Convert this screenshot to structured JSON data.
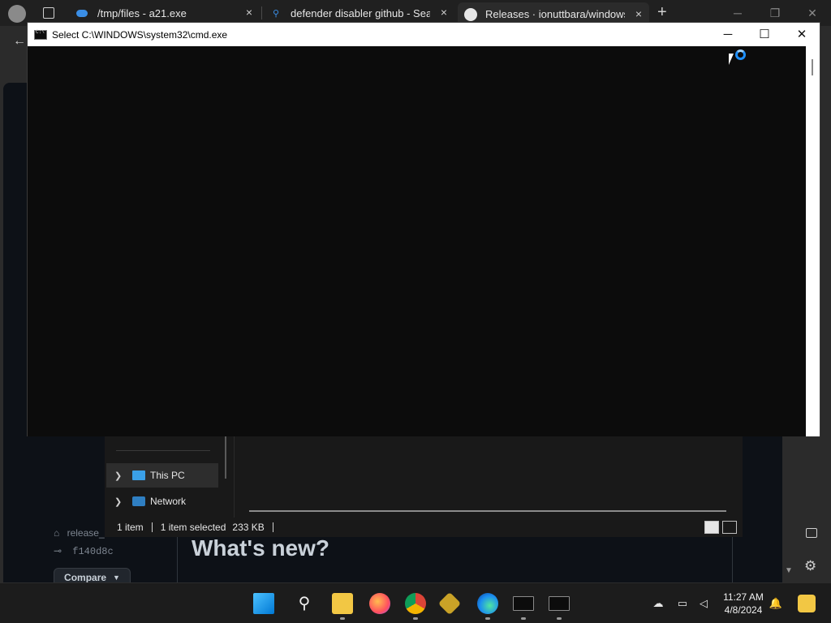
{
  "browser": {
    "tabs": [
      {
        "title": "/tmp/files - a21.exe",
        "icon": "cloud-icon"
      },
      {
        "title": "defender disabler github - Search",
        "icon": "search-icon"
      },
      {
        "title": "Releases · ionuttbara/windows-defender-remover",
        "icon": "github-icon"
      }
    ],
    "new_tab": "+"
  },
  "cmd": {
    "title": "Select C:\\WINDOWS\\system32\\cmd.exe",
    "min": "─",
    "max": "☐",
    "close": "✕"
  },
  "explorer": {
    "nav": [
      {
        "label": "This PC",
        "icon": "computer-icon"
      },
      {
        "label": "Network",
        "icon": "network-icon"
      }
    ],
    "status": {
      "count": "1 item",
      "selected": "1 item selected",
      "size": "233 KB"
    }
  },
  "github": {
    "tag": "release_",
    "commit": "f140d8c",
    "compare": "Compare",
    "heading": "What's new?"
  },
  "taskbar": {
    "time": "11:27 AM",
    "date": "4/8/2024"
  }
}
